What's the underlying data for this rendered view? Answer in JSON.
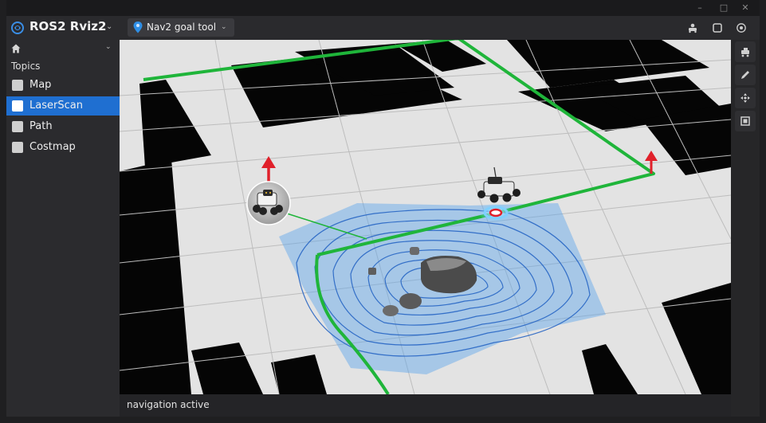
{
  "app": {
    "title": "ROS2 Rviz2"
  },
  "window_controls": {
    "minimize": "–",
    "maximize": "□",
    "close": "✕"
  },
  "toolbar": {
    "tool_label": "Nav2 goal tool",
    "icons": [
      "app-logo-icon",
      "chevron-down-icon",
      "map-pin-icon",
      "robot-icon",
      "square-icon",
      "target-icon"
    ]
  },
  "sidebar": {
    "heading": "Topics",
    "topics": [
      {
        "label": "Map",
        "checked": true,
        "selected": false
      },
      {
        "label": "LaserScan",
        "checked": true,
        "selected": true
      },
      {
        "label": "Path",
        "checked": true,
        "selected": false
      },
      {
        "label": "Costmap",
        "checked": true,
        "selected": false
      }
    ]
  },
  "right_tools": [
    "robot-pose-icon",
    "pencil-icon",
    "pan-icon",
    "frame-icon"
  ],
  "viewport": {
    "scene": "3d-map",
    "colors": {
      "path": "#1fb53a",
      "costmap": "#5aa4ea",
      "goal_arrow": "#e0202a",
      "grid_floor": "#e3e3e3",
      "obstacle": "#050505"
    }
  },
  "status": {
    "text": "navigation active"
  },
  "colors": {
    "accent": "#1f6fd1",
    "panel": "#2b2b2e",
    "background": "#1f1f21"
  }
}
